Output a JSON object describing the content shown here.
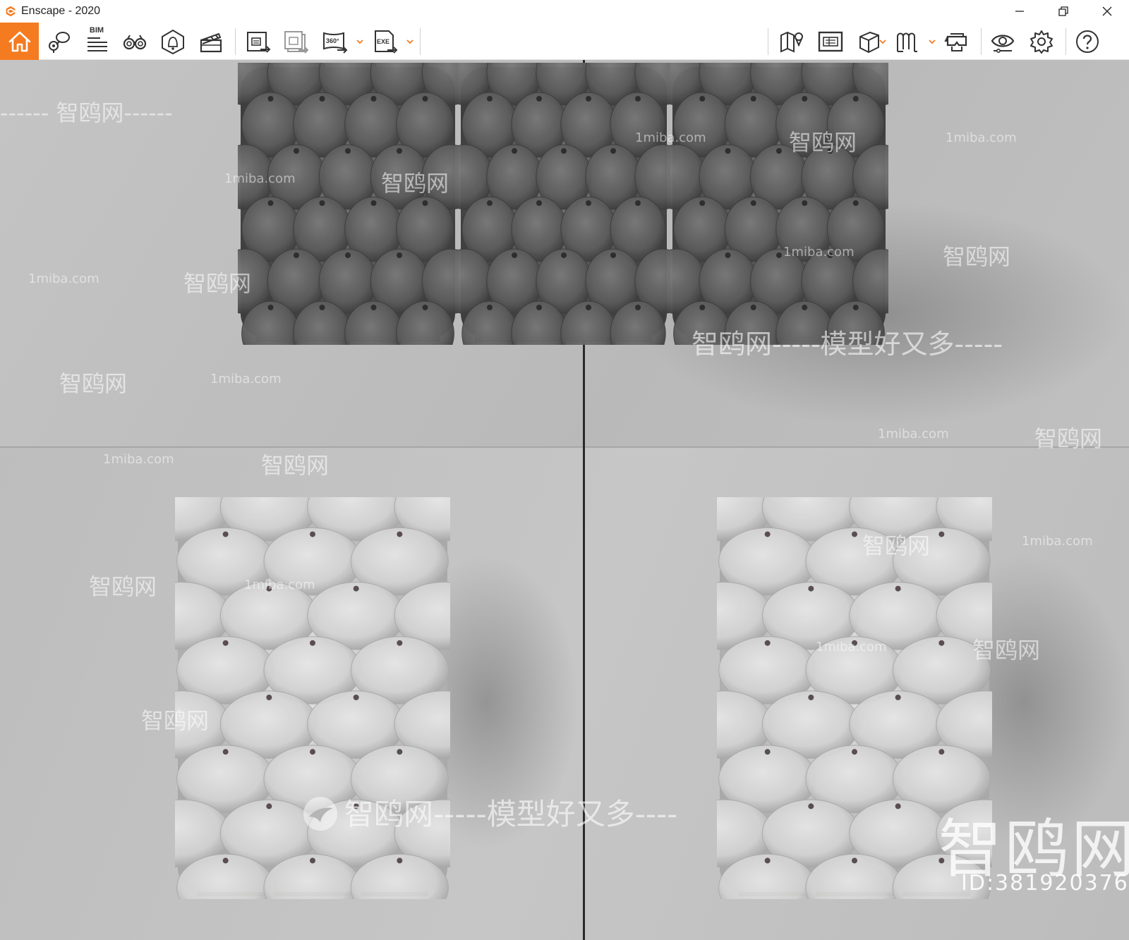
{
  "window": {
    "title": "Enscape - 2020",
    "accent_color": "#f47b20",
    "controls": [
      "minimize-icon",
      "restore-icon",
      "close-icon"
    ]
  },
  "toolbar": {
    "home": {
      "icon": "home-icon"
    },
    "left_group": [
      {
        "icon": "capture-view-icon"
      },
      {
        "label": "BIM",
        "icon": "bim-list-icon"
      },
      {
        "icon": "binoculars-icon"
      },
      {
        "icon": "sound-icon"
      },
      {
        "icon": "clapperboard-icon"
      }
    ],
    "export_group": [
      {
        "icon": "screenshot-export-icon"
      },
      {
        "icon": "batch-export-icon"
      },
      {
        "label": "360°",
        "icon": "panorama-export-icon",
        "has_dropdown": true
      },
      {
        "label": "EXE",
        "icon": "exe-export-icon",
        "has_dropdown": true
      }
    ],
    "right_group": [
      {
        "icon": "map-icon"
      },
      {
        "icon": "asset-library-icon"
      },
      {
        "icon": "cube-icon",
        "has_dropdown": true
      },
      {
        "icon": "vr-icon",
        "has_dropdown": true
      },
      {
        "icon": "vr-headset-icon"
      },
      {
        "icon": "visibility-icon"
      },
      {
        "icon": "settings-gear-icon"
      },
      {
        "icon": "help-icon"
      }
    ],
    "collapse_toggle": "chevron-up-icon"
  },
  "viewport": {
    "scene": "three tufted ottomans top view, two tufted ottomans perspective view",
    "watermarks": {
      "site_cn": "智鸥网",
      "site_en": "1miba.com",
      "slogan": "智鸥网-----模型好又多-----",
      "slogan_short": "智鸥网-----模型好又多----",
      "big_logo_text": "智鸥网",
      "id_text": "ID:381920376"
    }
  }
}
